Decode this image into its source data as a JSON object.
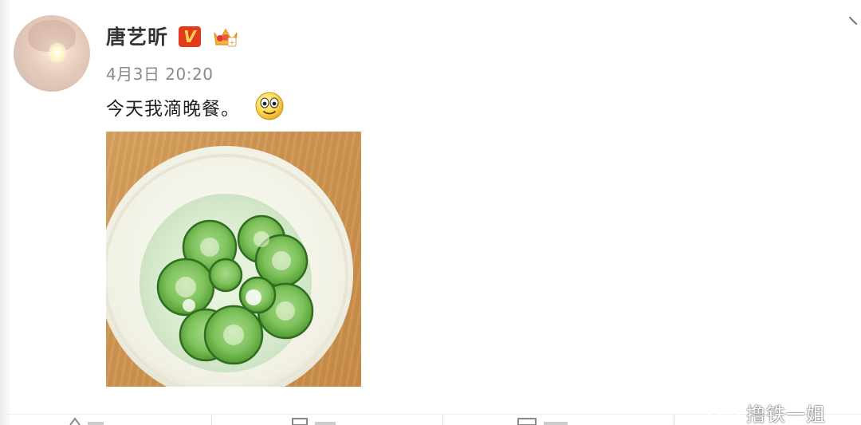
{
  "post": {
    "username": "唐艺昕",
    "verified_badge": "V",
    "verified_badge_color": "#e33a1b",
    "timestamp": "4月3日 20:20",
    "text": "今天我滴晚餐。",
    "emoji": "smiley-face",
    "photo": "bowl-of-cucumber-slices-in-water"
  },
  "icons": {
    "crown_badge": "crown-badge-icon",
    "more_menu": "chevron-down-icon",
    "footer": [
      "like-icon",
      "forward-icon",
      "comment-icon"
    ]
  },
  "watermark": {
    "text": "撸铁一姐",
    "icon": "wechat-icon"
  }
}
